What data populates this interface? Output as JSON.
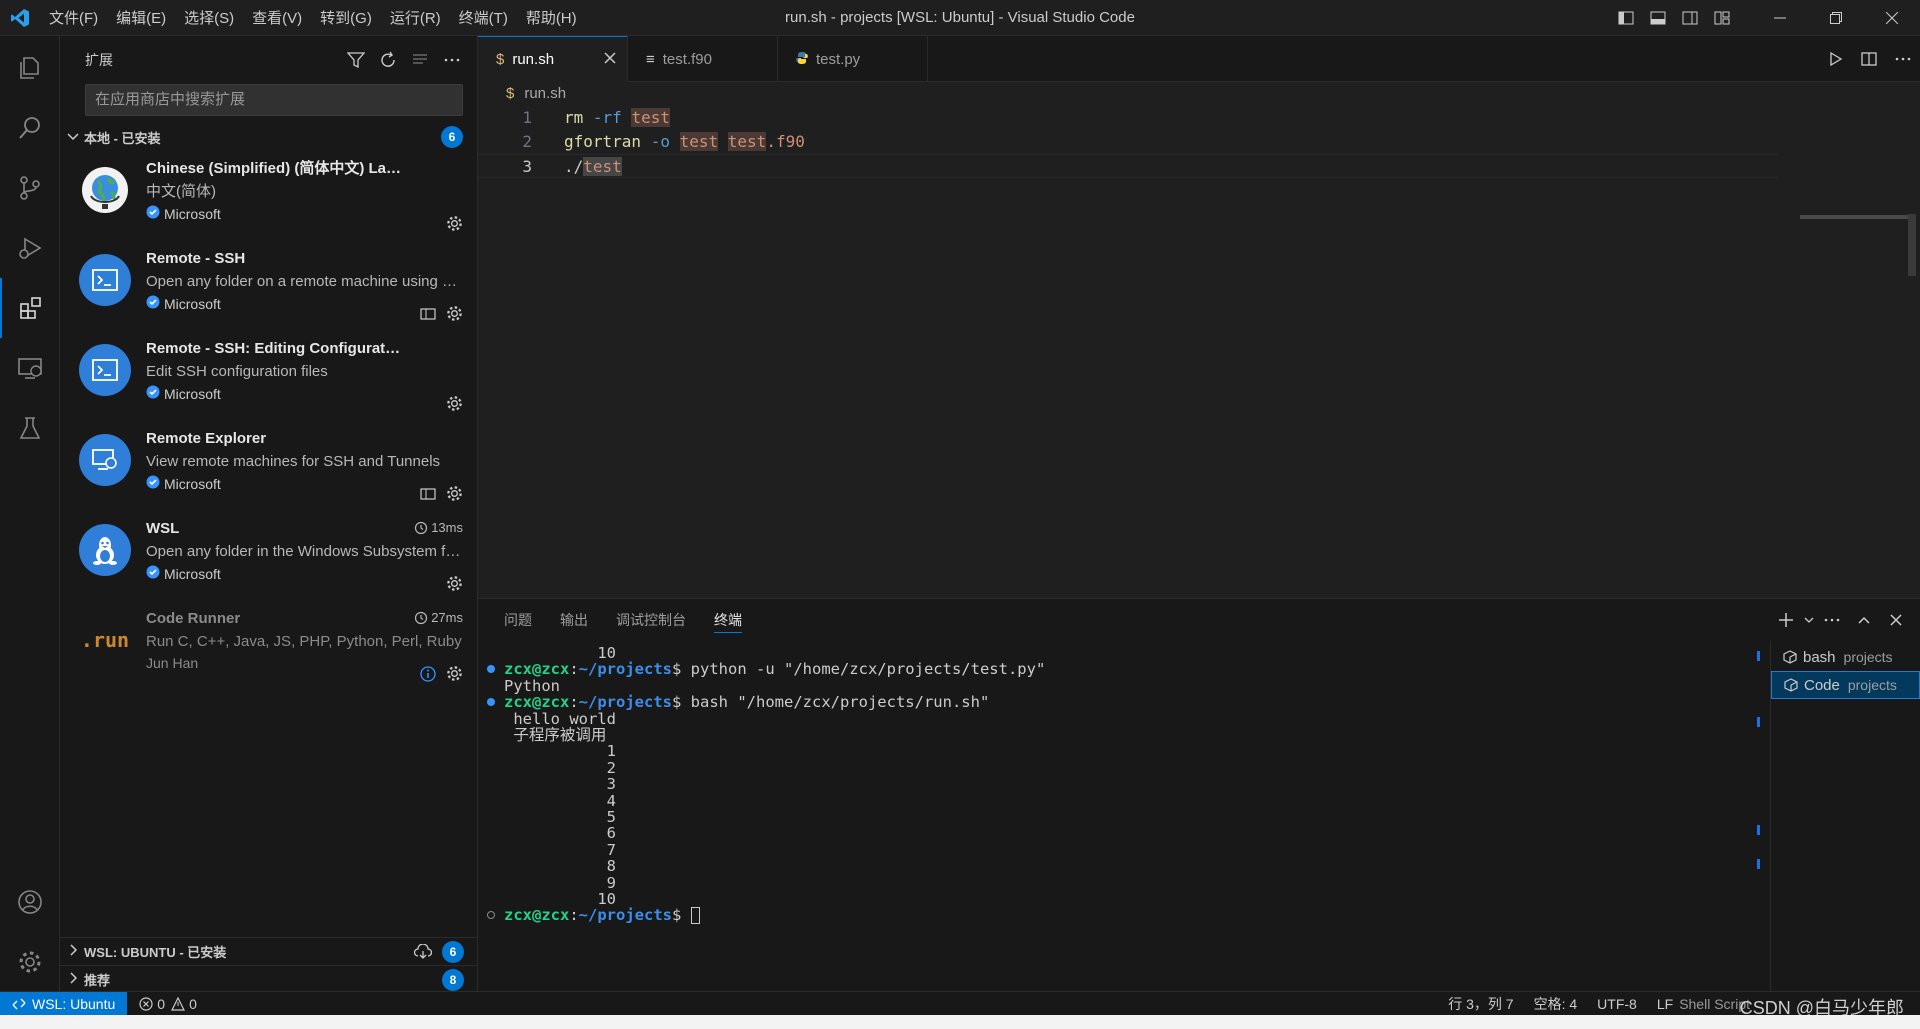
{
  "titlebar": {
    "menu": [
      "文件(F)",
      "编辑(E)",
      "选择(S)",
      "查看(V)",
      "转到(G)",
      "运行(R)",
      "终端(T)",
      "帮助(H)"
    ],
    "window_title": "run.sh - projects [WSL: Ubuntu] - Visual Studio Code",
    "accent": "#0078d4"
  },
  "sidebar": {
    "title": "扩展",
    "search_placeholder": "在应用商店中搜索扩展",
    "installed_section": "本地 - 已安装",
    "installed_count": "6",
    "extensions": [
      {
        "name": "Chinese (Simplified) (简体中文) Language Pack for Visual Studio Code",
        "desc": "中文(简体)",
        "publisher": "Microsoft",
        "icon": "globe-icon"
      },
      {
        "name": "Remote - SSH",
        "desc": "Open any folder on a remote machine using SSH",
        "publisher": "Microsoft",
        "icon": "terminal-icon"
      },
      {
        "name": "Remote - SSH: Editing Configuration Files",
        "desc": "Edit SSH configuration files",
        "publisher": "Microsoft",
        "icon": "terminal-icon"
      },
      {
        "name": "Remote Explorer",
        "desc": "View remote machines for SSH and Tunnels",
        "publisher": "Microsoft",
        "icon": "remote-explorer-icon"
      },
      {
        "name": "WSL",
        "desc": "Open any folder in the Windows Subsystem for Linux",
        "publisher": "Microsoft",
        "icon": "linux-icon",
        "time": "13ms"
      },
      {
        "name": "Code Runner",
        "desc": "Run C, C++, Java, JS, PHP, Python, Perl, Ruby",
        "publisher": "Jun Han",
        "icon": "run-logo",
        "time": "27ms",
        "logo_text": ".run"
      }
    ],
    "wsl_section": "WSL: UBUNTU - 已安装",
    "wsl_count": "6",
    "recommended_section": "推荐",
    "recommended_count": "8"
  },
  "editor": {
    "tabs": [
      {
        "label": "run.sh",
        "icon": "$",
        "active": true
      },
      {
        "label": "test.f90",
        "icon": "≡",
        "active": false
      },
      {
        "label": "test.py",
        "icon": "py",
        "active": false
      }
    ],
    "breadcrumb": "run.sh",
    "breadcrumb_icon": "$",
    "lines": [
      {
        "num": "1",
        "tokens": [
          {
            "t": "rm ",
            "c": "kw"
          },
          {
            "t": "-rf ",
            "c": "fl"
          },
          {
            "t": "test",
            "c": "hl"
          }
        ]
      },
      {
        "num": "2",
        "tokens": [
          {
            "t": "gfortran ",
            "c": "kw"
          },
          {
            "t": "-o ",
            "c": "fl"
          },
          {
            "t": "test",
            "c": "hl"
          },
          {
            "t": " ",
            "c": ""
          },
          {
            "t": "test",
            "c": "hl"
          },
          {
            "t": ".f90",
            "c": "str"
          }
        ]
      },
      {
        "num": "3",
        "tokens": [
          {
            "t": "./",
            "c": ""
          },
          {
            "t": "test",
            "c": "hl2"
          }
        ]
      }
    ]
  },
  "panel": {
    "tabs": [
      "问题",
      "输出",
      "调试控制台",
      "终端"
    ],
    "active_tab": "终端",
    "terminal": [
      {
        "text": "          10",
        "prompt": false
      },
      {
        "prompt": true,
        "user": "zcx@zcx",
        "path": "~/projects",
        "cmd": "python -u \"/home/zcx/projects/test.py\""
      },
      {
        "text": "Python",
        "prompt": false
      },
      {
        "prompt": true,
        "user": "zcx@zcx",
        "path": "~/projects",
        "cmd": "bash \"/home/zcx/projects/run.sh\""
      },
      {
        "text": " hello world",
        "prompt": false
      },
      {
        "text": " 子程序被调用",
        "prompt": false
      },
      {
        "text": "           1",
        "prompt": false
      },
      {
        "text": "           2",
        "prompt": false
      },
      {
        "text": "           3",
        "prompt": false
      },
      {
        "text": "           4",
        "prompt": false
      },
      {
        "text": "           5",
        "prompt": false
      },
      {
        "text": "           6",
        "prompt": false
      },
      {
        "text": "           7",
        "prompt": false
      },
      {
        "text": "           8",
        "prompt": false
      },
      {
        "text": "           9",
        "prompt": false
      },
      {
        "text": "          10",
        "prompt": false
      },
      {
        "prompt": true,
        "user": "zcx@zcx",
        "path": "~/projects",
        "cmd": "",
        "cursor": true,
        "hollow": true
      }
    ],
    "terminal_list": [
      {
        "name": "bash",
        "sub": "projects"
      },
      {
        "name": "Code",
        "sub": "projects"
      }
    ]
  },
  "statusbar": {
    "remote": "WSL: Ubuntu",
    "errors": "0",
    "warnings": "0",
    "position": "行 3，列 7",
    "spaces": "空格: 4",
    "encoding": "UTF-8",
    "eol": "LF",
    "language": "Shell Script",
    "watermark": "CSDN @白马少年郎"
  }
}
